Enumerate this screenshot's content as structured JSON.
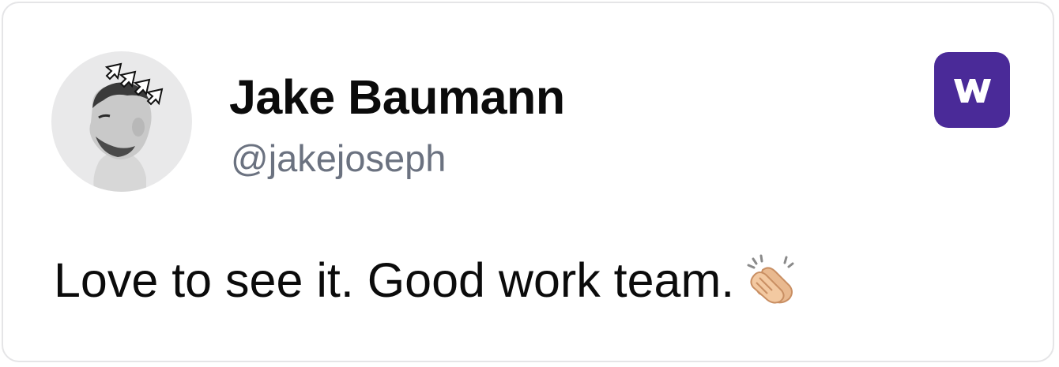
{
  "post": {
    "author_name": "Jake Baumann",
    "author_handle": "@jakejoseph",
    "message": "Love to see it. Good work team.",
    "reaction_emoji": "clapping-hands-icon"
  },
  "brand": {
    "logo_icon": "w-logo-icon",
    "logo_color": "#4a2a98"
  },
  "colors": {
    "handle_text": "#6b7280",
    "card_border": "#e5e5e7",
    "body_text": "#0b0b0b"
  }
}
